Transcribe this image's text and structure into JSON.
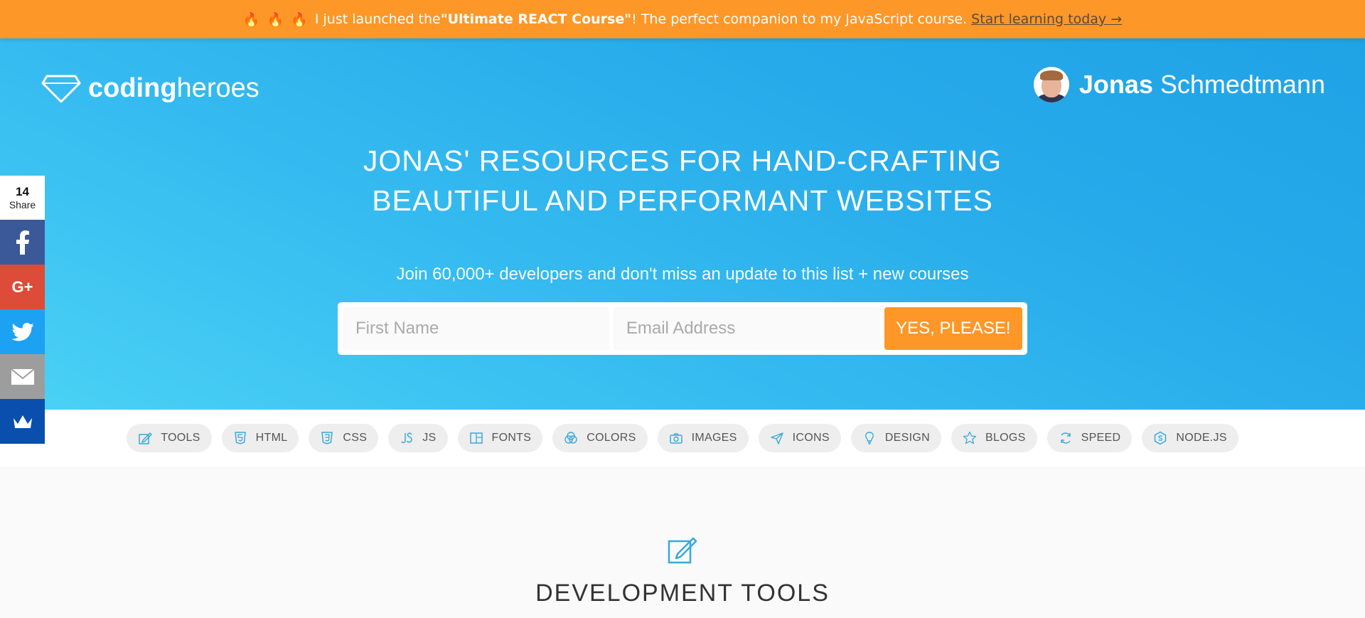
{
  "banner": {
    "text_before": "I just launched the ",
    "course": "\"Ultimate REACT Course\"",
    "text_after": "! The perfect companion to my JavaScript course.",
    "link": "Start learning today →"
  },
  "logo": {
    "part1": "coding",
    "part2": "heroes"
  },
  "author": {
    "first": "Jonas",
    "last": "Schmedtmann"
  },
  "hero": {
    "headline_line1": "JONAS' RESOURCES FOR HAND-CRAFTING",
    "headline_line2": "BEAUTIFUL AND PERFORMANT WEBSITES",
    "subline": "Join 60,000+ developers and don't miss an update to this list + new courses"
  },
  "signup": {
    "first_name_placeholder": "First Name",
    "email_placeholder": "Email Address",
    "submit_label": "YES, PLEASE!"
  },
  "share": {
    "count": "14",
    "label": "Share"
  },
  "categories": [
    {
      "label": "TOOLS",
      "icon": "edit-icon"
    },
    {
      "label": "HTML",
      "icon": "html5-icon"
    },
    {
      "label": "CSS",
      "icon": "css3-icon"
    },
    {
      "label": "JS",
      "icon": "js-icon"
    },
    {
      "label": "FONTS",
      "icon": "fonts-icon"
    },
    {
      "label": "COLORS",
      "icon": "colors-icon"
    },
    {
      "label": "IMAGES",
      "icon": "camera-icon"
    },
    {
      "label": "ICONS",
      "icon": "paper-plane-icon"
    },
    {
      "label": "DESIGN",
      "icon": "lightbulb-icon"
    },
    {
      "label": "BLOGS",
      "icon": "star-icon"
    },
    {
      "label": "SPEED",
      "icon": "refresh-icon"
    },
    {
      "label": "NODE.JS",
      "icon": "nodejs-icon"
    }
  ],
  "section": {
    "title": "DEVELOPMENT TOOLS",
    "icon": "edit-icon"
  },
  "colors": {
    "accent": "#fd9727",
    "hero_blue": "#27aaea",
    "icon_blue": "#39a9dc"
  }
}
